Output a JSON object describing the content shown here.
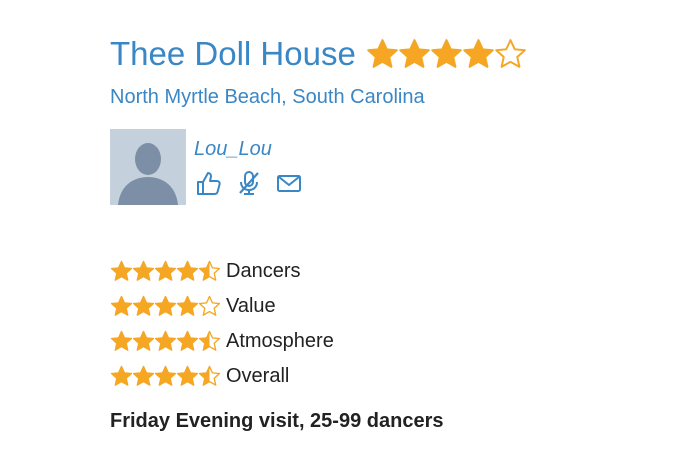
{
  "club": {
    "name": "Thee Doll House",
    "rating": 4,
    "rating_max": 5
  },
  "location": {
    "city": "North Myrtle Beach",
    "separator": ",",
    "state": "South Carolina"
  },
  "reviewer": {
    "username": "Lou_Lou",
    "actions": [
      {
        "name": "like-icon"
      },
      {
        "name": "mute-microphone-icon"
      },
      {
        "name": "message-icon"
      }
    ]
  },
  "ratings": [
    {
      "label": "Dancers",
      "rating": 4.5
    },
    {
      "label": "Value",
      "rating": 4
    },
    {
      "label": "Atmosphere",
      "rating": 4.5
    },
    {
      "label": "Overall",
      "rating": 4.5
    }
  ],
  "visit": {
    "text": "Friday Evening visit, 25-99 dancers"
  },
  "colors": {
    "link": "#3a87c6",
    "star": "#f5a623",
    "text": "#222222"
  }
}
